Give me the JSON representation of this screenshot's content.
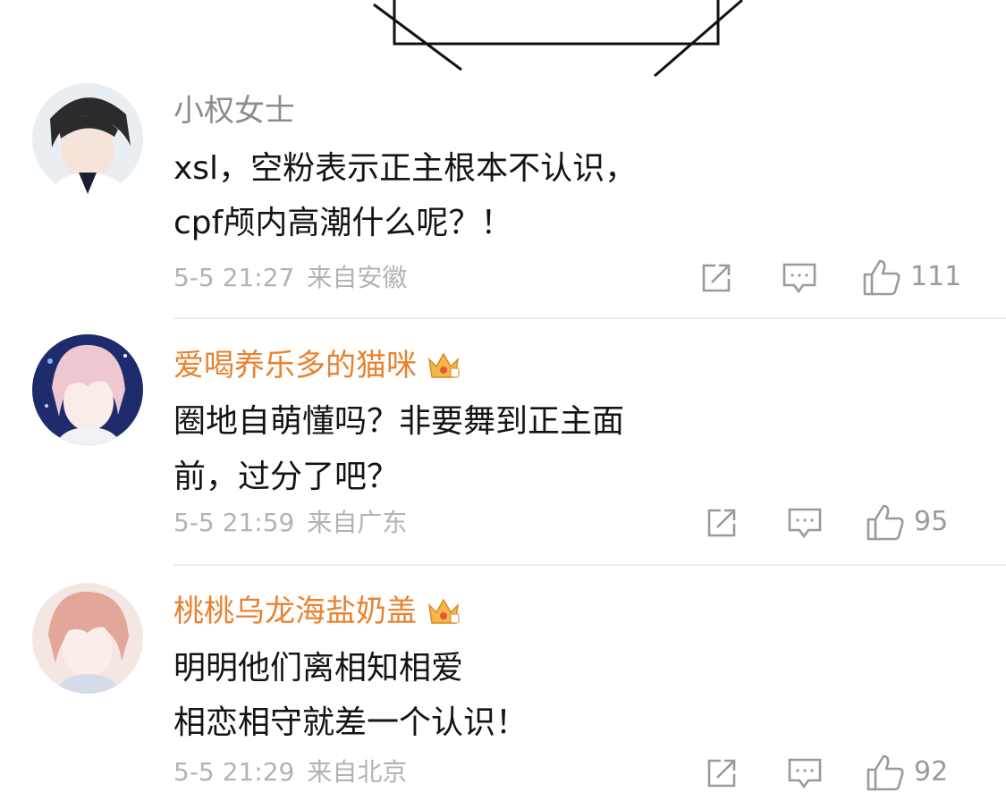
{
  "comments": [
    {
      "username": "小权女士",
      "vip": false,
      "lines": [
        "xsl，空粉表示正主根本不认识，",
        "cpf颅内高潮什么呢？！"
      ],
      "date": "5-5 21:27",
      "location": "来自安徽",
      "likes": "111",
      "avatar_icon": "dark-haired-boy-avatar"
    },
    {
      "username": "爱喝养乐多的猫咪",
      "vip": true,
      "lines": [
        "圈地自萌懂吗？非要舞到正主面",
        "前，过分了吧？"
      ],
      "date": "5-5 21:59",
      "location": "来自广东",
      "likes": "95",
      "avatar_icon": "pink-haired-boy-avatar"
    },
    {
      "username": "桃桃乌龙海盐奶盖",
      "vip": true,
      "lines": [
        "明明他们离相知相爱",
        "相恋相守就差一个认识！"
      ],
      "date": "5-5 21:29",
      "location": "来自北京",
      "likes": "92",
      "avatar_icon": "peach-haired-boy-avatar"
    }
  ],
  "colors": {
    "vip_name": "#e8822f",
    "plain_name": "#8c8c8c",
    "meta": "#b3b3b3",
    "icon": "#9a9a9a"
  },
  "icons": [
    "share-icon",
    "reply-icon",
    "like-icon",
    "vip-crown-icon"
  ]
}
